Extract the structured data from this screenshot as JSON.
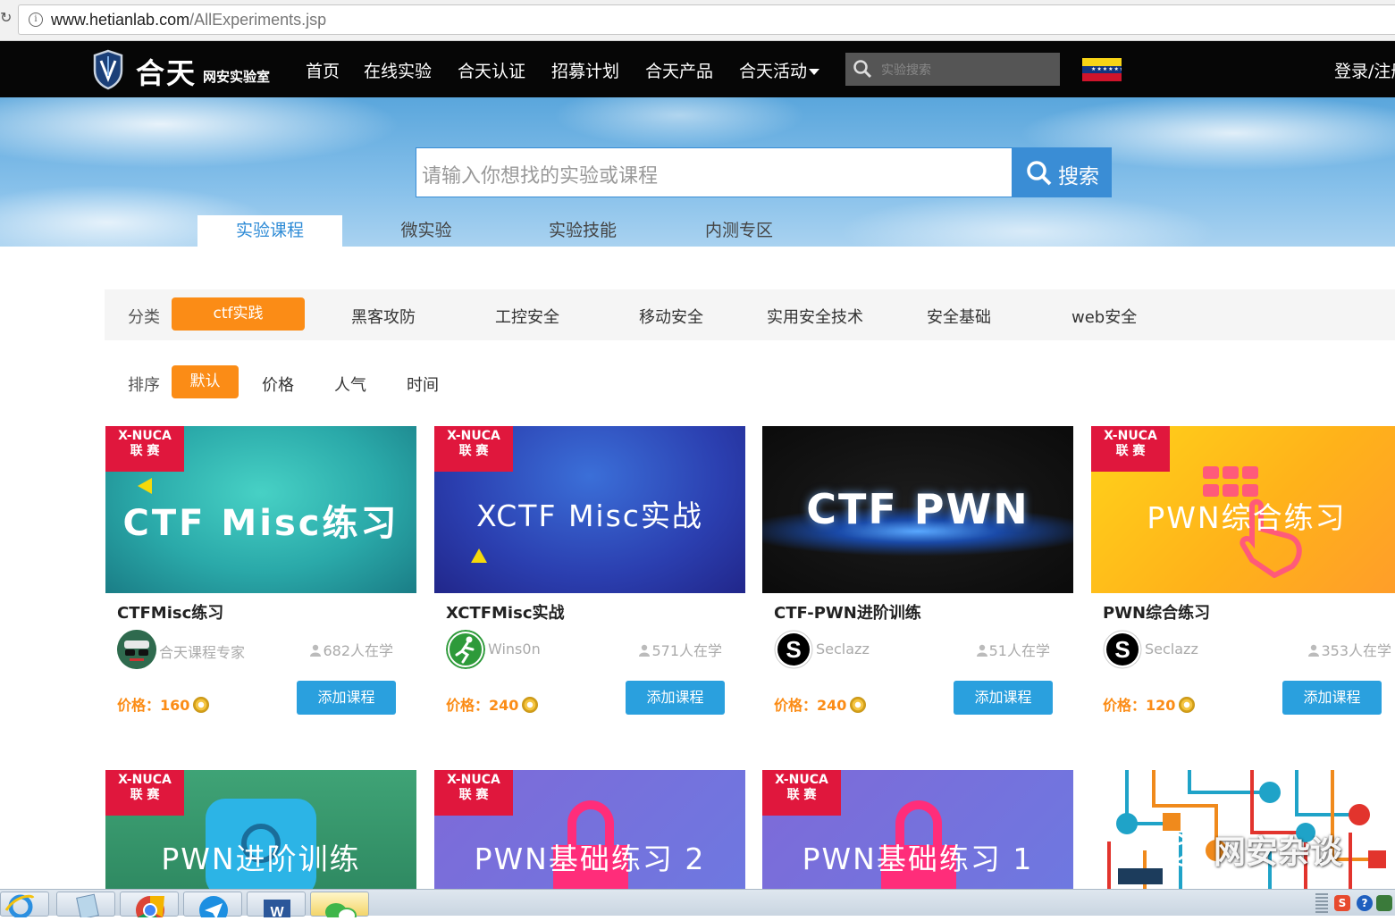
{
  "browser": {
    "url_host": "www.hetianlab.com",
    "url_path": "/AllExperiments.jsp"
  },
  "nav": {
    "logo_text": "合天",
    "logo_sub": "网安实验室",
    "items": [
      "首页",
      "在线实验",
      "合天认证",
      "招募计划",
      "合天产品",
      "合天活动"
    ],
    "search_placeholder": "实验搜索",
    "login": "登录/注册"
  },
  "hero": {
    "search_placeholder": "请输入你想找的实验或课程",
    "search_button": "搜索",
    "tabs": [
      "实验课程",
      "微实验",
      "实验技能",
      "内测专区"
    ],
    "active_tab": "实验课程"
  },
  "filters": {
    "category_label": "分类",
    "categories": [
      "ctf实践",
      "黑客攻防",
      "工控安全",
      "移动安全",
      "实用安全技术",
      "安全基础",
      "web安全"
    ],
    "active_category": "ctf实践",
    "sort_label": "排序",
    "sorts": [
      "默认",
      "价格",
      "人气",
      "时间"
    ],
    "active_sort": "默认"
  },
  "ribbon": {
    "line1": "X-NUCA",
    "line2": "联 赛"
  },
  "courses": [
    {
      "thumb_title": "CTF Misc练习",
      "title": "CTFMisc练习",
      "author": "合天课程专家",
      "learners": "682人在学",
      "price_label": "价格：",
      "price": "160",
      "button": "添加课程"
    },
    {
      "thumb_title": "XCTF Misc实战",
      "title": "XCTFMisc实战",
      "author": "Wins0n",
      "learners": "571人在学",
      "price_label": "价格：",
      "price": "240",
      "button": "添加课程"
    },
    {
      "thumb_title": "CTF  PWN",
      "title": "CTF-PWN进阶训练",
      "author": "Seclazz",
      "learners": "51人在学",
      "price_label": "价格：",
      "price": "240",
      "button": "添加课程"
    },
    {
      "thumb_title": "PWN综合练习",
      "title": "PWN综合练习",
      "author": "Seclazz",
      "learners": "353人在学",
      "price_label": "价格：",
      "price": "120",
      "button": "添加课程"
    }
  ],
  "courses_row2": [
    {
      "thumb_title": "PWN进阶训练"
    },
    {
      "thumb_title": "PWN基础练习 2"
    },
    {
      "thumb_title": "PWN基础练习 1"
    }
  ],
  "watermark": "网安杂谈",
  "colors": {
    "accent_orange": "#fb8c16",
    "button_blue": "#2aa0de",
    "nav_bg": "#060606",
    "ribbon_red": "#e0173d"
  }
}
